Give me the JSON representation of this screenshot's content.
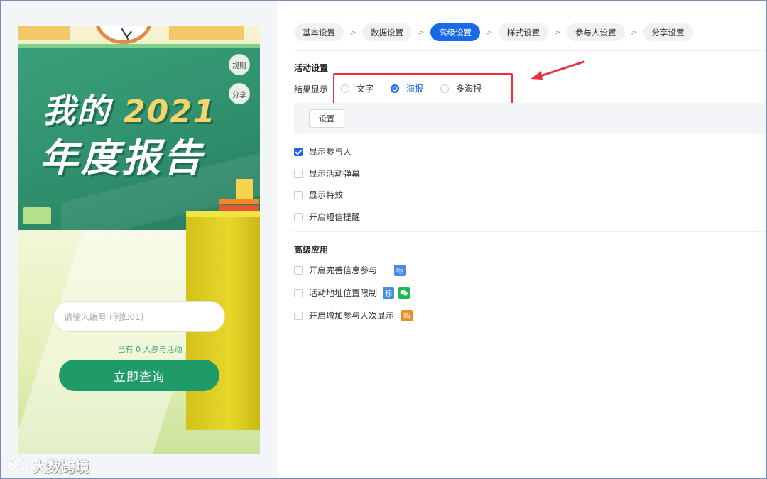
{
  "preview": {
    "title_line1": "我的",
    "title_year": "2021",
    "title_line2": "年度报告",
    "rules_btn": "规则",
    "share_btn": "分享",
    "input_placeholder": "请输入编号 (例如01)",
    "participant_count_text": "已有 0 人参与活动",
    "query_btn": "立即查询"
  },
  "watermark": {
    "text": "大数跨境"
  },
  "steps": [
    {
      "label": "基本设置",
      "active": false
    },
    {
      "label": "数据设置",
      "active": false
    },
    {
      "label": "高级设置",
      "active": true
    },
    {
      "label": "样式设置",
      "active": false
    },
    {
      "label": "参与人设置",
      "active": false
    },
    {
      "label": "分享设置",
      "active": false
    }
  ],
  "step_separator": ">",
  "activity_settings": {
    "title": "活动设置",
    "result_display_label": "结果显示",
    "result_options": [
      {
        "label": "文字",
        "checked": false
      },
      {
        "label": "海报",
        "checked": true
      },
      {
        "label": "多海报",
        "checked": false
      }
    ],
    "setting_btn": "设置",
    "checkboxes": [
      {
        "label": "显示参与人",
        "checked": true
      },
      {
        "label": "显示活动弹幕",
        "checked": false
      },
      {
        "label": "显示特效",
        "checked": false
      },
      {
        "label": "开启短信提醒",
        "checked": false
      }
    ]
  },
  "advanced_apps": {
    "title": "高级应用",
    "items": [
      {
        "label": "开启完善信息参与",
        "tags": [
          {
            "text": "标",
            "color": "#4a8de8"
          }
        ]
      },
      {
        "label": "活动地址位置限制",
        "tags": [
          {
            "text": "标",
            "color": "#4a8de8"
          },
          {
            "text": "wechat-icon",
            "color": "#1db954"
          }
        ]
      },
      {
        "label": "开启增加参与人次显示",
        "tags": [
          {
            "text": "购",
            "color": "#f08a24"
          }
        ]
      }
    ]
  },
  "colors": {
    "primary": "#1868e8",
    "highlight": "#e8333b",
    "preview_green": "#1f9b6a"
  }
}
